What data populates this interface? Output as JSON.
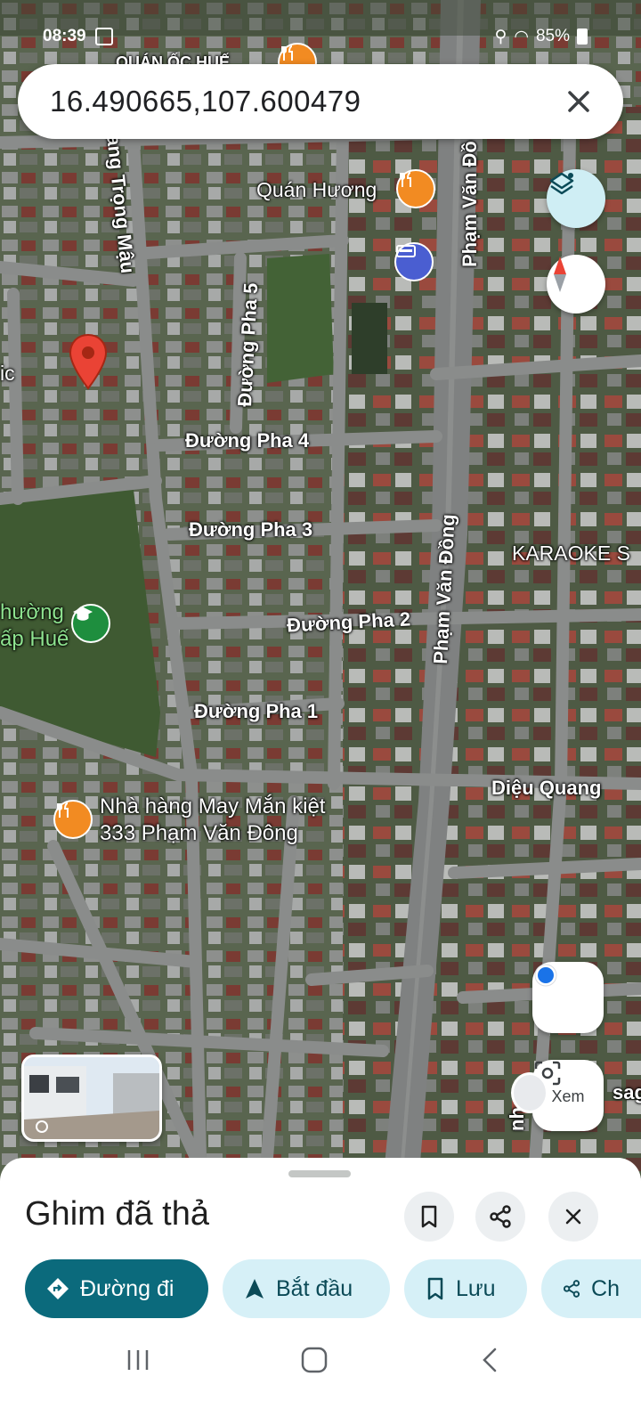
{
  "status_bar": {
    "time": "08:39",
    "battery": "85%"
  },
  "search": {
    "query": "16.490665,107.600479",
    "clear_icon": "close-icon"
  },
  "map": {
    "streets": {
      "pham_van_dong_top": "Phạm Văn Đồ",
      "pham_van_dong": "Phạm Văn Đồng",
      "hoang_trong_mau": "ang Trọng Mậu",
      "pha5": "Đường Pha 5",
      "pha4": "Đường Pha 4",
      "pha3": "Đường Pha 3",
      "pha2": "Đường Pha 2",
      "pha1": "Đường Pha 1",
      "dieu_quang": "Diệu Quang",
      "partial_sag": "sag",
      "partial_nh": "nh"
    },
    "places": {
      "quan_huong": "Quán Hương",
      "quan_oc_hue": "QUÁN ỐC HUẾ",
      "karaoke": "KARAOKE S",
      "school_line1": "hường",
      "school_line2": "ấp Huế",
      "restaurant_line1": "Nhà hàng May Mắn kiệt",
      "restaurant_line2": "333 Phạm Văn Đông",
      "left_partial": "ic"
    },
    "colors": {
      "pin": "#ea4335",
      "food_poi": "#f28b22",
      "school_poi": "#1e8e3e",
      "atm_poi": "#4a5ed1"
    },
    "controls": {
      "layers_icon": "layers-icon",
      "compass_icon": "compass-icon",
      "location_icon": "my-location-icon",
      "lens_label": "Xem",
      "lens_icon": "camera-lens-icon",
      "streetview_icon": "street-view-icon"
    }
  },
  "sheet": {
    "title": "Ghim đã thả",
    "actions": {
      "directions": "Đường đi",
      "start": "Bắt đầu",
      "save": "Lưu",
      "share": "Ch"
    },
    "accent": "#0b6a7c",
    "chip_bg": "#d6f0f7"
  }
}
